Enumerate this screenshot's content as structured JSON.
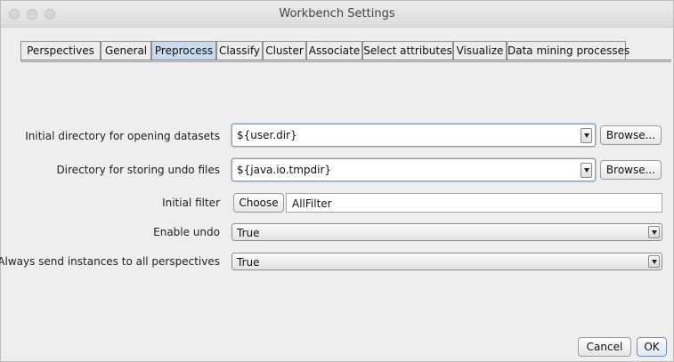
{
  "window": {
    "title": "Workbench Settings"
  },
  "tabs": [
    {
      "label": "Perspectives"
    },
    {
      "label": "General"
    },
    {
      "label": "Preprocess"
    },
    {
      "label": "Classify"
    },
    {
      "label": "Cluster"
    },
    {
      "label": "Associate"
    },
    {
      "label": "Select attributes"
    },
    {
      "label": "Visualize"
    },
    {
      "label": "Data mining processes"
    }
  ],
  "active_tab": "Preprocess",
  "form": {
    "initial_directory": {
      "label": "Initial directory for opening datasets",
      "value": "${user.dir}",
      "browse_label": "Browse..."
    },
    "undo_directory": {
      "label": "Directory for storing undo files",
      "value": "${java.io.tmpdir}",
      "browse_label": "Browse..."
    },
    "initial_filter": {
      "label": "Initial filter",
      "choose_label": "Choose",
      "value": "AllFilter"
    },
    "enable_undo": {
      "label": "Enable undo",
      "value": "True"
    },
    "send_instances": {
      "label": "Always send instances to all perspectives",
      "value": "True"
    }
  },
  "footer": {
    "cancel_label": "Cancel",
    "ok_label": "OK"
  },
  "colors": {
    "active_tab": "#c9d9ef",
    "focus_ring": "#b9cde8"
  }
}
